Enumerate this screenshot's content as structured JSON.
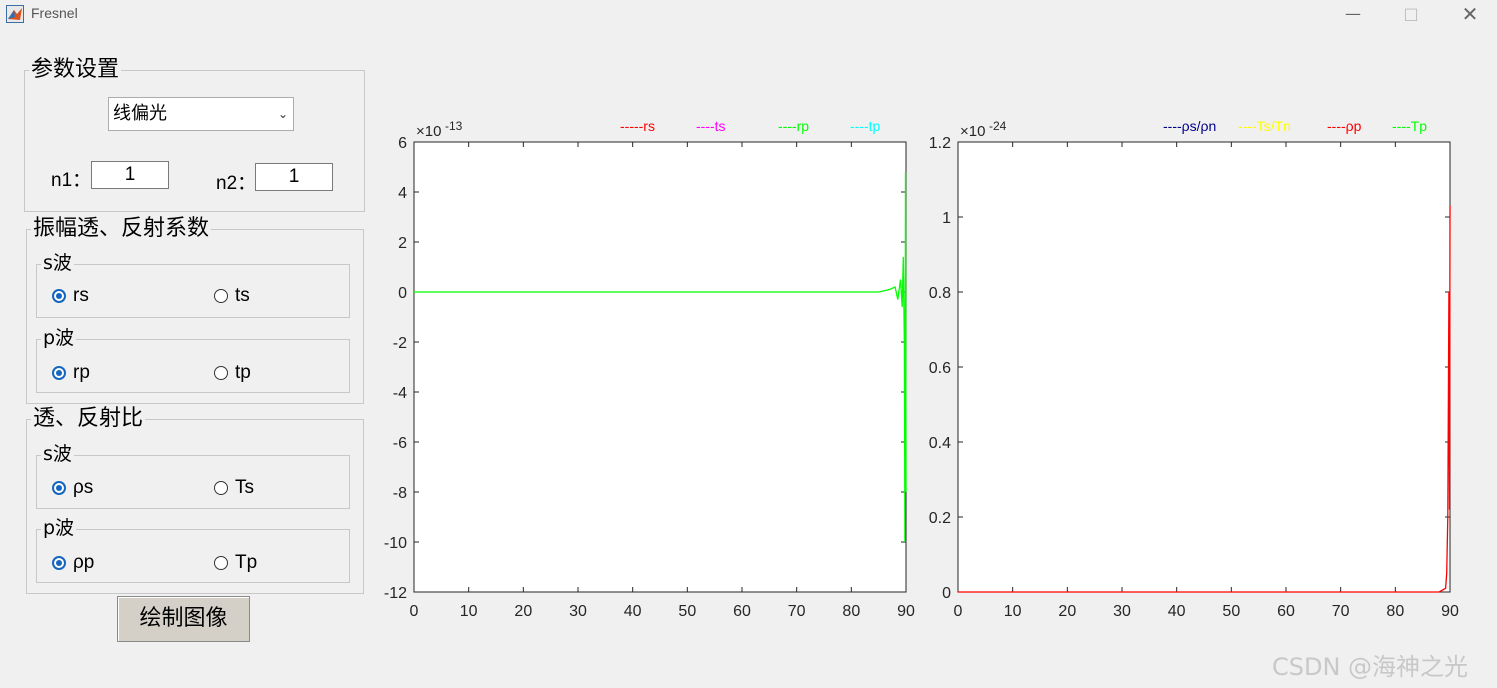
{
  "window": {
    "title": "Fresnel",
    "minimize": "—",
    "maximize": "□",
    "close": "✕"
  },
  "params": {
    "title": "参数设置",
    "mode_selected": "线偏光",
    "n1_label": "n1：",
    "n1_value": "1",
    "n2_label": "n2：",
    "n2_value": "1"
  },
  "coeff": {
    "title": "振幅透、反射系数",
    "s_title": "s波",
    "rs": "rs",
    "ts": "ts",
    "p_title": "p波",
    "rp": "rp",
    "tp": "tp"
  },
  "ratio": {
    "title": "透、反射比",
    "s_title": "s波",
    "rho_s": "ρs",
    "Ts": "Ts",
    "p_title": "p波",
    "rho_p": "ρp",
    "Tp": "Tp"
  },
  "plot_button": "绘制图像",
  "watermark": "CSDN @海神之光",
  "chart_data": [
    {
      "type": "line",
      "x_ticks": [
        "0",
        "10",
        "20",
        "30",
        "40",
        "50",
        "60",
        "70",
        "80",
        "90"
      ],
      "y_ticks": [
        "6",
        "4",
        "2",
        "0",
        "-2",
        "-4",
        "-6",
        "-8",
        "-10",
        "-12"
      ],
      "xlim": [
        0,
        90
      ],
      "ylim": [
        -12,
        6
      ],
      "y_exponent_base": "×10",
      "y_exponent": "-13",
      "legend": [
        {
          "label": "-----rs",
          "color": "#ff0000"
        },
        {
          "label": "----ts",
          "color": "#ff00ff"
        },
        {
          "label": "----rp",
          "color": "#00ff00"
        },
        {
          "label": "----tp",
          "color": "#00ffff"
        }
      ],
      "series": [
        {
          "color": "#00ff00",
          "x": [
            0,
            10,
            20,
            30,
            40,
            50,
            60,
            70,
            80,
            85,
            87,
            88,
            88.5,
            89,
            89.3,
            89.5,
            89.7,
            89.8,
            89.9,
            90
          ],
          "y": [
            0,
            0,
            0,
            0,
            0,
            0,
            0,
            0,
            0,
            0,
            0.1,
            0.2,
            -0.3,
            0.5,
            -0.6,
            1.4,
            -2.2,
            -10.0,
            4.8,
            -8.0
          ]
        }
      ]
    },
    {
      "type": "line",
      "x_ticks": [
        "0",
        "10",
        "20",
        "30",
        "40",
        "50",
        "60",
        "70",
        "80",
        "90"
      ],
      "y_ticks": [
        "1.2",
        "1",
        "0.8",
        "0.6",
        "0.4",
        "0.2",
        "0"
      ],
      "xlim": [
        0,
        90
      ],
      "ylim": [
        0,
        1.2
      ],
      "y_exponent_base": "×10",
      "y_exponent": "-24",
      "legend": [
        {
          "label": "----ρs/ρn",
          "color": "#00008b"
        },
        {
          "label": "----Ts/Tn",
          "color": "#ffff00"
        },
        {
          "label": "----ρp",
          "color": "#ff0000"
        },
        {
          "label": "----Tp",
          "color": "#00ff00"
        }
      ],
      "series": [
        {
          "color": "#ff0000",
          "x": [
            0,
            10,
            20,
            30,
            40,
            50,
            60,
            70,
            80,
            88,
            89.2,
            89.4,
            89.6,
            89.8,
            89.9,
            90
          ],
          "y": [
            0,
            0,
            0,
            0,
            0,
            0,
            0,
            0,
            0,
            0,
            0.01,
            0.05,
            0.2,
            0.8,
            0.22,
            1.03
          ]
        }
      ]
    }
  ]
}
